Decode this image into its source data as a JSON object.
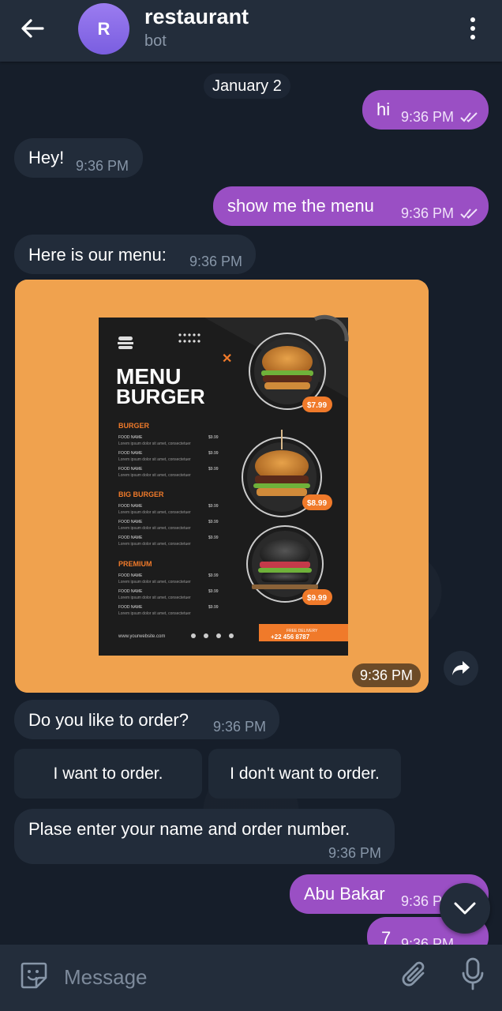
{
  "header": {
    "avatar_letter": "R",
    "title": "restaurant",
    "subtitle": "bot"
  },
  "date_separator": "January 2",
  "messages": [
    {
      "dir": "out",
      "text": "hi",
      "time": "9:36 PM"
    },
    {
      "dir": "in",
      "text": "Hey!",
      "time": "9:36 PM"
    },
    {
      "dir": "out",
      "text": "show me the menu",
      "time": "9:36 PM"
    },
    {
      "dir": "in",
      "text": "Here is our menu:",
      "time": "9:36 PM"
    },
    {
      "dir": "in",
      "type": "image",
      "time": "9:36 PM"
    },
    {
      "dir": "in",
      "text": "Do you like to order?",
      "time": "9:36 PM"
    },
    {
      "dir": "in",
      "text": "Plase enter your name and order number.",
      "time": "9:36 PM"
    },
    {
      "dir": "out",
      "text": "Abu Bakar",
      "time": "9:36 PM"
    },
    {
      "dir": "out",
      "text": "7",
      "time": "9:36 PM"
    }
  ],
  "menu_image": {
    "heading1": "MENU",
    "heading2": "BURGER",
    "sections": [
      "BURGER",
      "BIG BURGER",
      "PREMIUM"
    ],
    "item_name": "FOOD NAME",
    "item_desc": "Lorem ipsum dolor sit amet, consectetuer",
    "item_price": "$9.99",
    "prices": [
      "$7.99",
      "$8.99",
      "$9.99"
    ],
    "website": "www.yourwebsite.com",
    "delivery_label": "FREE DELIVERY",
    "phone": "+22 456 8787"
  },
  "keyboard_buttons": [
    "I want to order.",
    "I don't want to order."
  ],
  "input": {
    "placeholder": "Message"
  },
  "colors": {
    "header_bg": "#232d3b",
    "chat_bg": "#161e2a",
    "incoming_bubble": "#222c3a",
    "outgoing_bubble": "#9a4fc4",
    "image_bg": "#f0a24e"
  }
}
